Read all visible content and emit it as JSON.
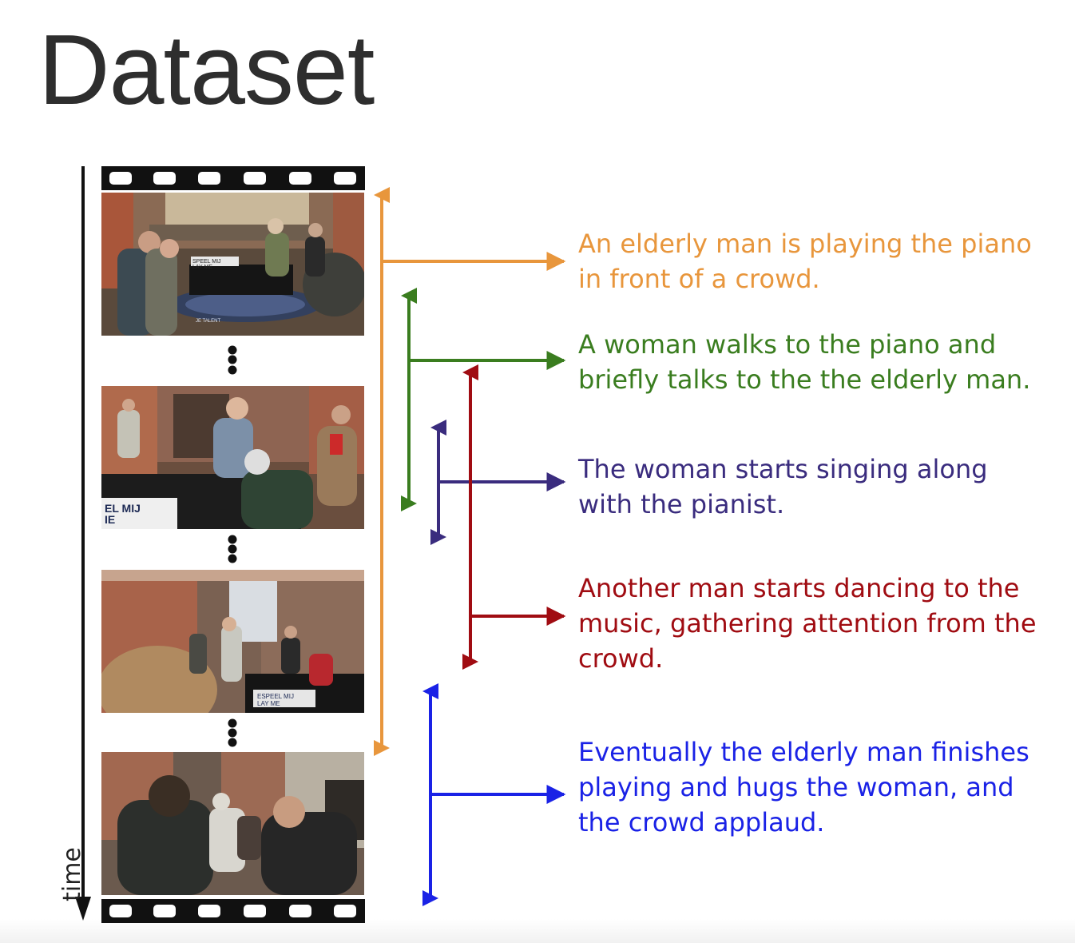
{
  "title": "Dataset",
  "time_label": "time",
  "colors": {
    "orange": "#e8963c",
    "green": "#3a7d1f",
    "purple": "#3a2c7e",
    "red": "#a00c12",
    "blue": "#1a22e6",
    "axis": "#111111"
  },
  "captions": [
    {
      "id": "caption-1",
      "color": "#e8963c",
      "lines": [
        "An elderly man is playing the piano",
        "in front of a crowd."
      ]
    },
    {
      "id": "caption-2",
      "color": "#3a7d1f",
      "lines": [
        "A woman walks to the piano and",
        "briefly talks to the the elderly man."
      ]
    },
    {
      "id": "caption-3",
      "color": "#3a2c7e",
      "lines": [
        "The woman starts singing along",
        "with the pianist."
      ]
    },
    {
      "id": "caption-4",
      "color": "#a00c12",
      "lines": [
        "Another man starts dancing to the",
        "music, gathering attention from the",
        "crowd."
      ]
    },
    {
      "id": "caption-5",
      "color": "#1a22e6",
      "lines": [
        "Eventually the elderly man finishes",
        "playing and hugs the woman, and",
        "the crowd applaud."
      ]
    }
  ],
  "frames": [
    {
      "name": "video-frame-1",
      "sign_text": [
        "SPEEL MIJ",
        "LAY ME"
      ],
      "mat_text": "JE TALENT"
    },
    {
      "name": "video-frame-2",
      "sign_text": [
        "EL MIJ",
        "IE"
      ],
      "mat_text": ""
    },
    {
      "name": "video-frame-3",
      "sign_text": [
        "ESPEEL MIJ",
        "LAY ME"
      ],
      "mat_text": ""
    },
    {
      "name": "video-frame-4",
      "sign_text": [],
      "mat_text": ""
    }
  ]
}
